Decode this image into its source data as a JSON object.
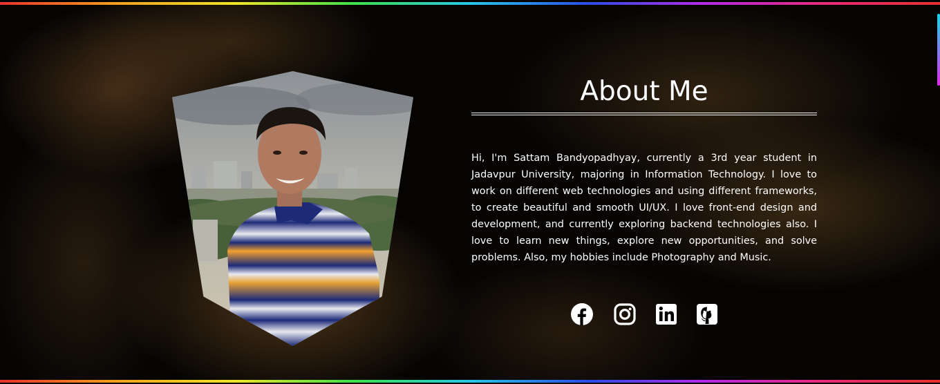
{
  "about": {
    "title": "About Me",
    "bio": "Hi, I'm Sattam Bandyopadhyay, currently a 3rd year student in Jadavpur University, majoring in Information Technology. I love to work on different web technologies and using different frameworks, to create beautiful and smooth UI/UX. I love front-end design and development, and currently exploring backend technologies also. I love to learn new things, explore new opportunities, and solve problems. Also, my hobbies include Photography and Music."
  },
  "socials": [
    {
      "name": "Facebook",
      "icon": "facebook-icon"
    },
    {
      "name": "Instagram",
      "icon": "instagram-icon"
    },
    {
      "name": "LinkedIn",
      "icon": "linkedin-icon"
    },
    {
      "name": "GitHub",
      "icon": "github-icon"
    }
  ],
  "colors": {
    "text": "#ffffff",
    "background": "#000000",
    "accent_gradient": [
      "#e8312b",
      "#f3a21f",
      "#f0e52a",
      "#3fe24a",
      "#28c8e8",
      "#2a4de8",
      "#b72ae8",
      "#e82a7c"
    ]
  }
}
